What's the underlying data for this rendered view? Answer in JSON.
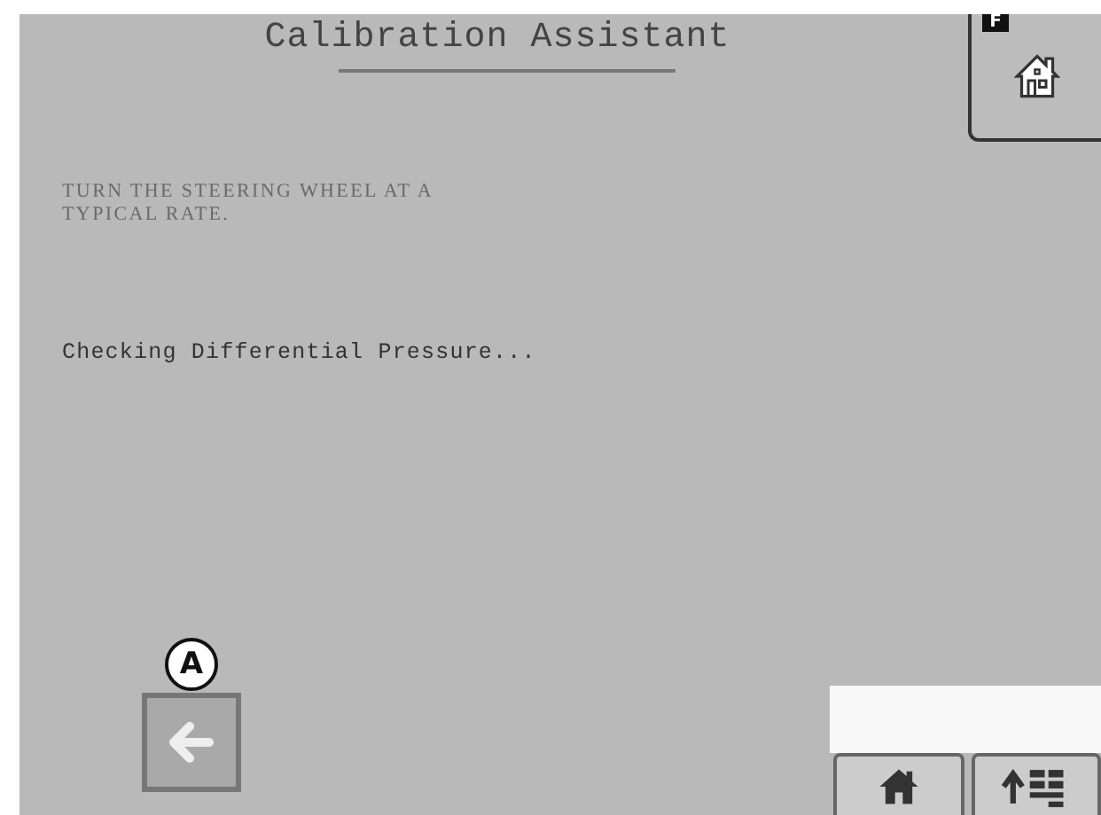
{
  "title": "Calibration Assistant",
  "instruction": "TURN THE STEERING WHEEL AT A\nTYPICAL RATE.",
  "status": "Checking Differential Pressure...",
  "callouts": [
    {
      "label": "F",
      "kind": "square"
    },
    {
      "label": "A",
      "kind": "circle"
    }
  ]
}
